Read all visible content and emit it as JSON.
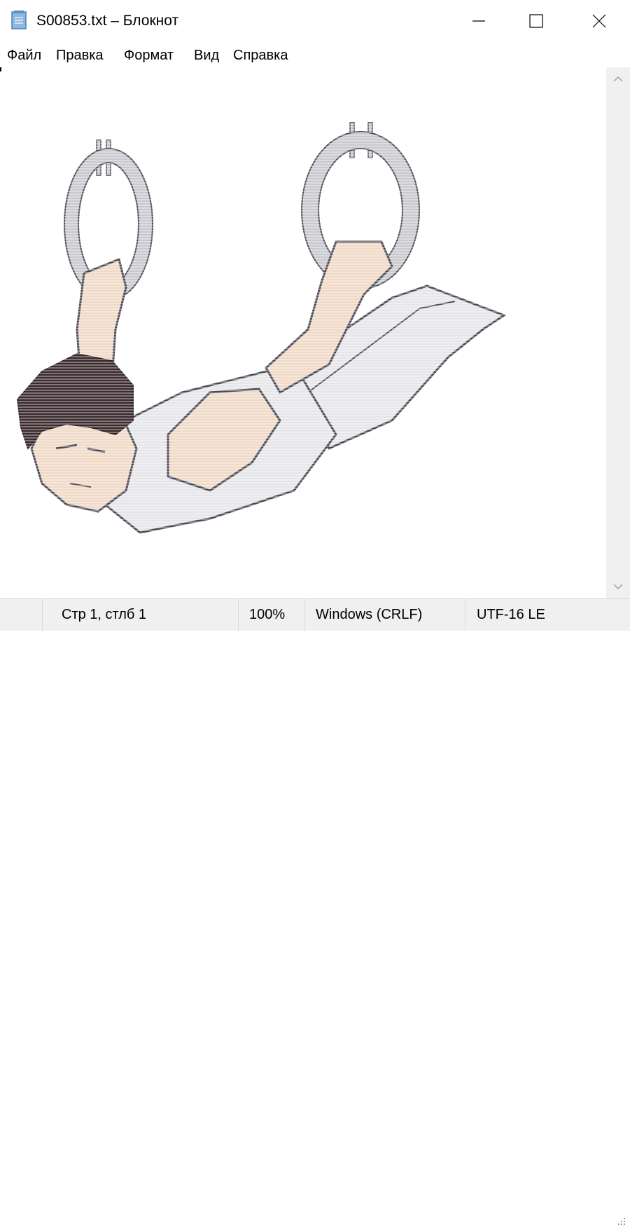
{
  "window": {
    "title": "S00853.txt – Блокнот",
    "controls": {
      "minimize": "minimize",
      "maximize": "maximize",
      "close": "close"
    }
  },
  "menu": {
    "items": [
      {
        "label": "Файл"
      },
      {
        "label": "Правка"
      },
      {
        "label": "Формат"
      },
      {
        "label": "Вид"
      },
      {
        "label": "Справка"
      }
    ]
  },
  "editor": {
    "content_kind": "ascii-art illustration of a gymnast on still rings"
  },
  "statusbar": {
    "position": "Стр 1, стлб 1",
    "zoom": "100%",
    "line_endings": "Windows (CRLF)",
    "encoding": "UTF-16 LE"
  },
  "colors": {
    "skin": "#f0d9c6",
    "hair": "#3b2a2e",
    "ring": "#c9c9cf",
    "outline": "#4a4a55",
    "shirt": "#e6e6ea",
    "statusbar_bg": "#f0f0f0"
  }
}
